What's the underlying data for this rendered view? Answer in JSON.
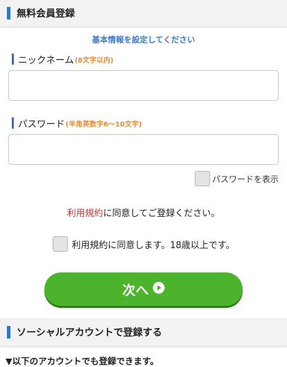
{
  "sections": {
    "registration_title": "無料会員登録",
    "social_title": "ソーシャルアカウントで登録する"
  },
  "form": {
    "subtitle": "基本情報を設定してください",
    "nickname_label": "ニックネーム",
    "nickname_note": "(8文字以内)",
    "nickname_value": "",
    "password_label": "パスワード",
    "password_note": "(半角英数字6～10文字)",
    "password_value": "",
    "show_password_label": "パスワードを表示",
    "show_password_checked": false
  },
  "agreement": {
    "terms_link": "利用規約",
    "text_rest": "に同意してご登録ください。",
    "checkbox_label": "利用規約に同意します。18歳以上です。",
    "checked": false
  },
  "next_button": {
    "label": "次へ",
    "icon": "play-circle-icon"
  },
  "footer": {
    "note": "▼以下のアカウントでも登録できます。"
  },
  "colors": {
    "accent_blue": "#2f6fd6",
    "note_orange": "#f08a2e",
    "link_red": "#d4323a",
    "button_green": "#4bb32c"
  }
}
